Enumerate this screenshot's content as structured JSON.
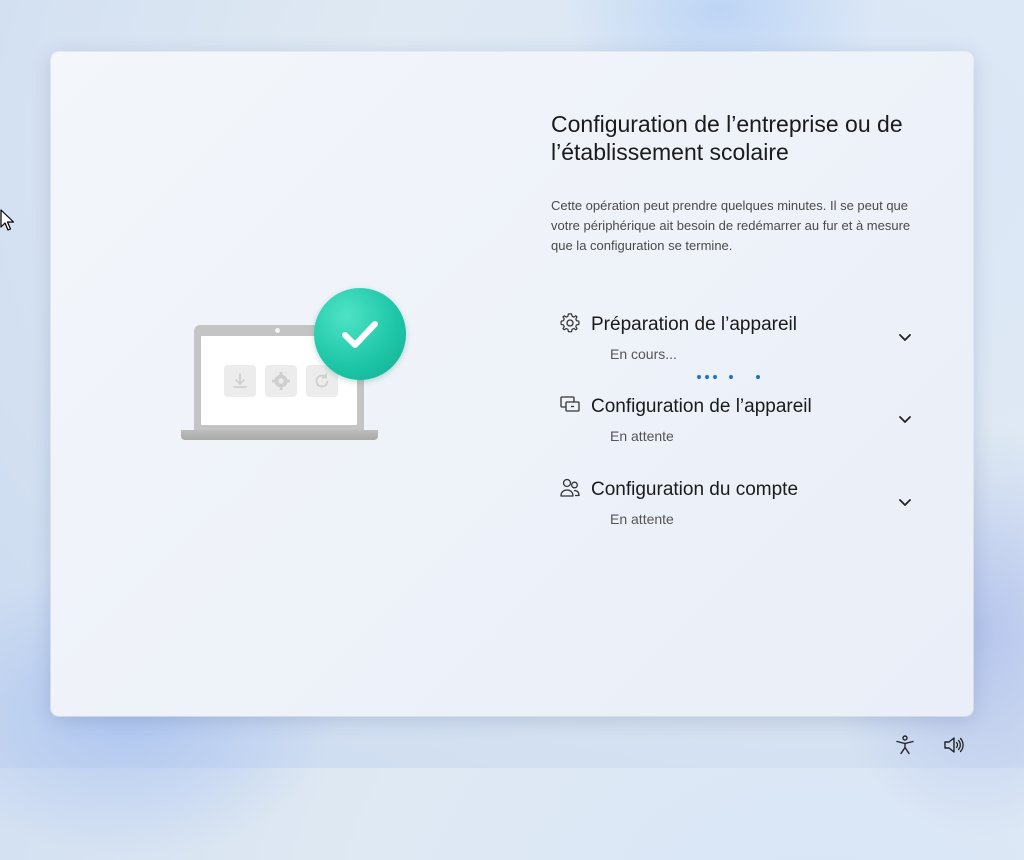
{
  "title": "Configuration de l’entreprise ou de l’établissement scolaire",
  "description": "Cette opération peut prendre quelques minutes. Il se peut que votre périphérique ait besoin de redémarrer au fur et à mesure que la configuration se termine.",
  "steps": [
    {
      "label": "Préparation de l’appareil",
      "status": "En cours...",
      "icon": "gear-icon"
    },
    {
      "label": "Configuration de l’appareil",
      "status": "En attente",
      "icon": "devices-icon"
    },
    {
      "label": "Configuration du compte",
      "status": "En attente",
      "icon": "people-icon"
    }
  ],
  "colors": {
    "accent": "#1a73c9",
    "check_badge": "#1fc7a8"
  },
  "tray": [
    "accessibility-icon",
    "volume-icon"
  ]
}
